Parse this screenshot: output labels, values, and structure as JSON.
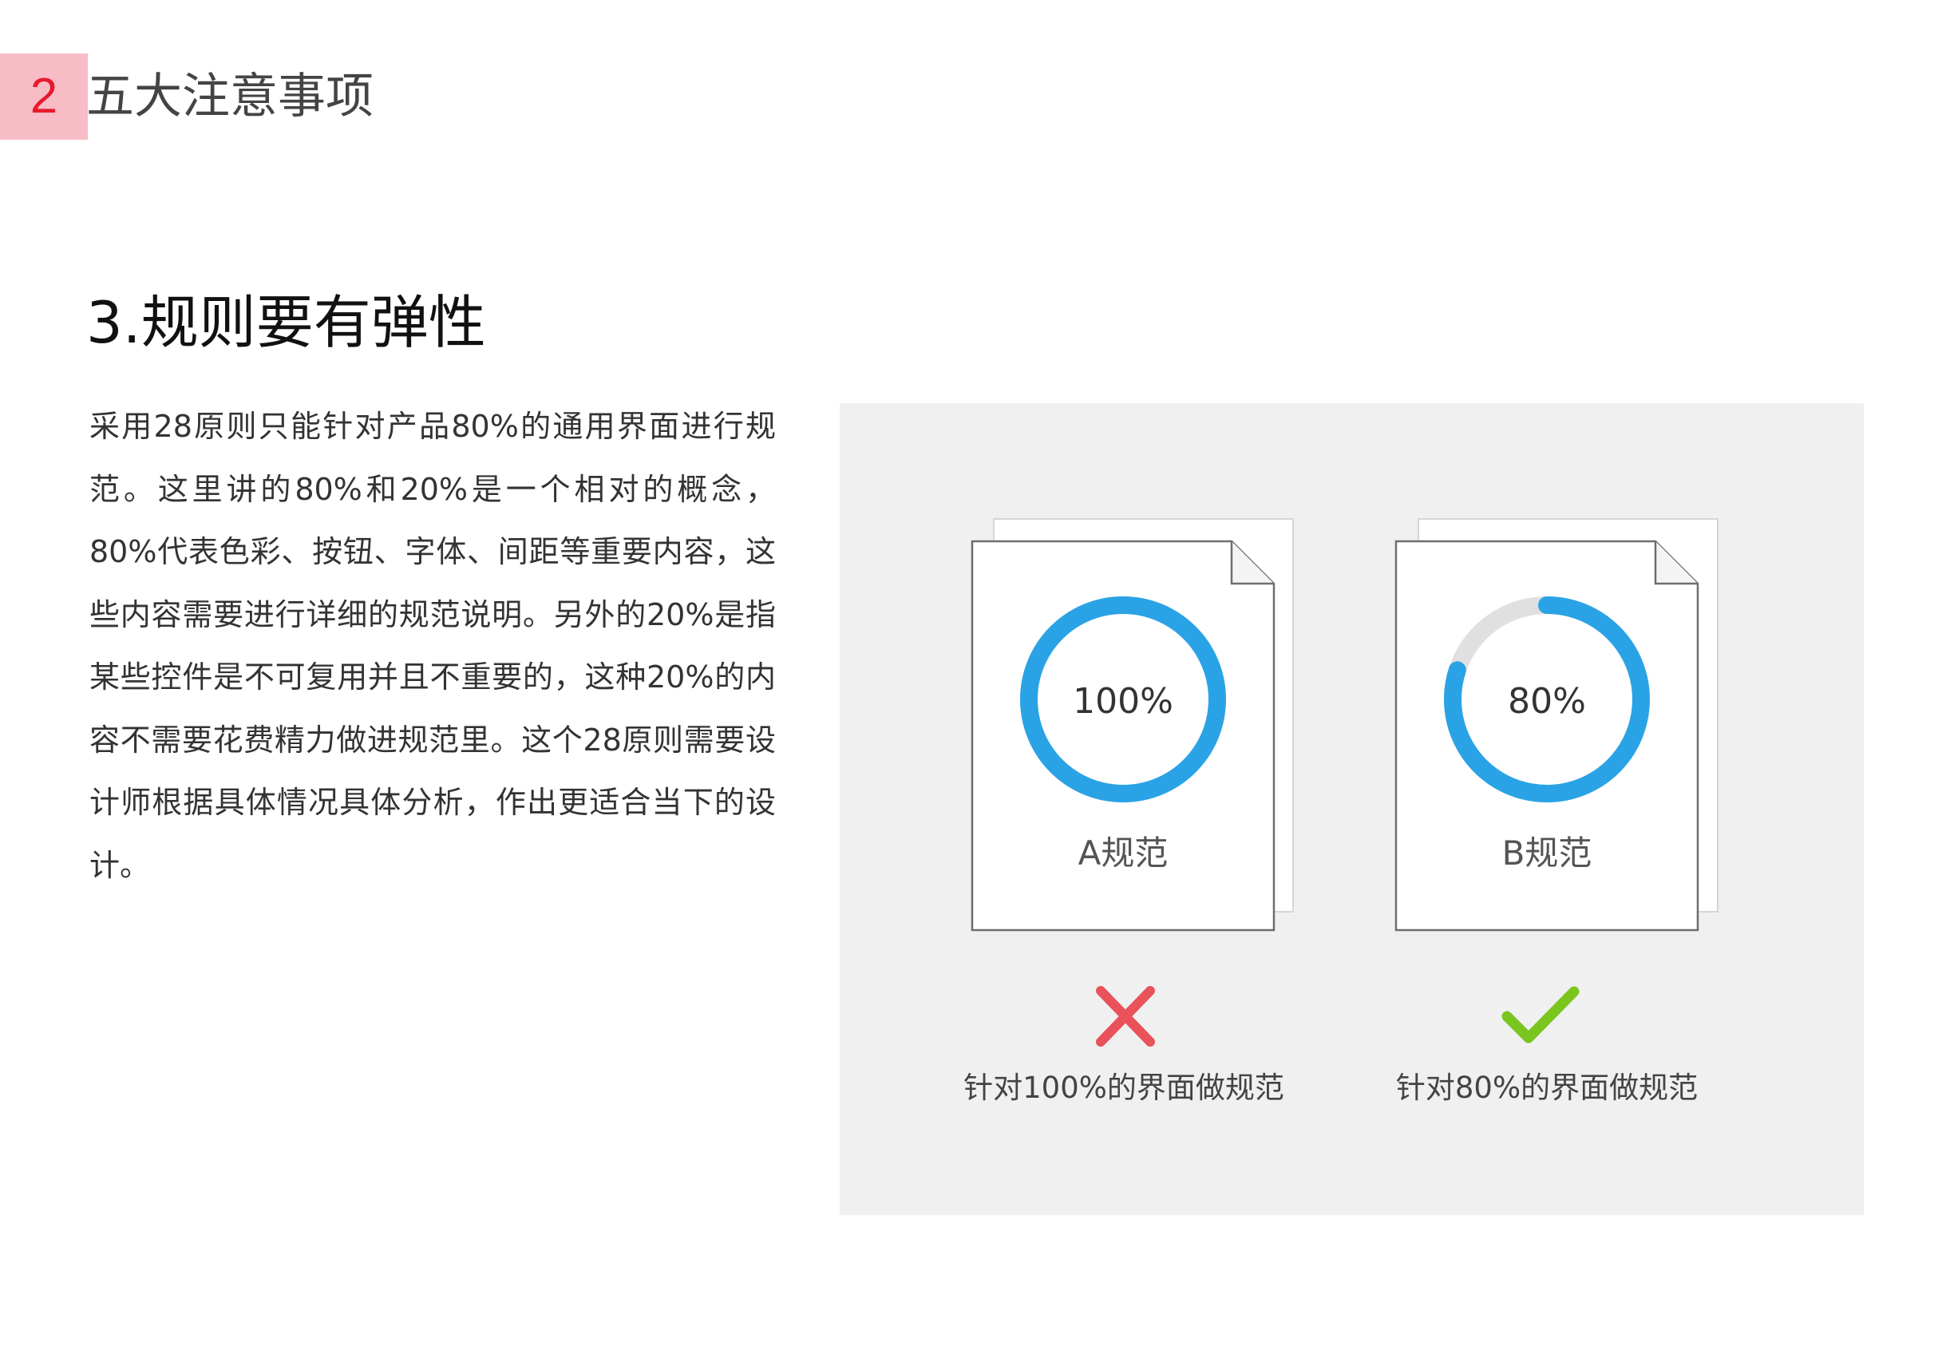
{
  "section": {
    "number": "2",
    "title": "五大注意事项"
  },
  "heading": "3.规则要有弹性",
  "paragraph": "采用28原则只能针对产品80%的通用界面进行规范。这里讲的80%和20%是一个相对的概念，80%代表色彩、按钮、字体、间距等重要内容，这些内容需要进行详细的规范说明。另外的20%是指某些控件是不可复用并且不重要的，这种20%的内容不需要花费精力做进规范里。这个28原则需要设计师根据具体情况具体分析，作出更适合当下的设计。",
  "illustration": {
    "cards": [
      {
        "percent_label": "100%",
        "progress": 1.0,
        "card_label": "A规范",
        "verdict": "wrong",
        "verdict_icon": "cross-icon",
        "caption": "针对100%的界面做规范"
      },
      {
        "percent_label": "80%",
        "progress": 0.8,
        "card_label": "B规范",
        "verdict": "right",
        "verdict_icon": "check-icon",
        "caption": "针对80%的界面做规范"
      }
    ],
    "colors": {
      "ring": "#2aa3e6",
      "ring_track": "#e0e0e0",
      "cross": "#e9525b",
      "check": "#7bc51f",
      "panel_bg": "#f0f0f0",
      "accent_badge_bg": "#f8bcc6",
      "accent_badge_text": "#e8192c"
    }
  }
}
